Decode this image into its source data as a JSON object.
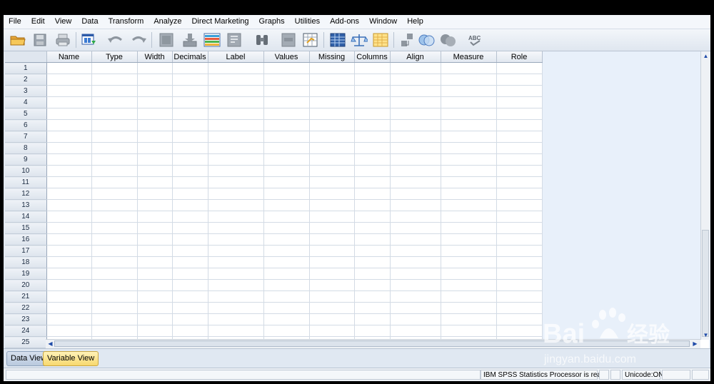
{
  "menu": [
    "File",
    "Edit",
    "View",
    "Data",
    "Transform",
    "Analyze",
    "Direct Marketing",
    "Graphs",
    "Utilities",
    "Add-ons",
    "Window",
    "Help"
  ],
  "toolbar": [
    "open-folder-icon",
    "save-icon",
    "print-icon",
    "recall-dialog-icon",
    "undo-icon",
    "redo-icon",
    "goto-case-icon",
    "goto-variable-icon",
    "variables-icon",
    "run-descriptives-icon",
    "find-icon",
    "insert-cases-icon",
    "insert-variable-icon",
    "split-file-icon",
    "weight-cases-icon",
    "select-cases-icon",
    "value-labels-icon",
    "use-sets-icon",
    "show-all-variables-icon",
    "spell-check-icon"
  ],
  "grid": {
    "columns": [
      "Name",
      "Type",
      "Width",
      "Decimals",
      "Label",
      "Values",
      "Missing",
      "Columns",
      "Align",
      "Measure",
      "Role"
    ],
    "rows": [
      "1",
      "2",
      "3",
      "4",
      "5",
      "6",
      "7",
      "8",
      "9",
      "10",
      "11",
      "12",
      "13",
      "14",
      "15",
      "16",
      "17",
      "18",
      "19",
      "20",
      "21",
      "22",
      "23",
      "24",
      "25"
    ]
  },
  "tabs": {
    "data_view": "Data View",
    "variable_view": "Variable View"
  },
  "status": {
    "processor": "IBM SPSS Statistics Processor is ready",
    "unicode": "Unicode:ON"
  },
  "watermark": {
    "brand": "Bai",
    "brand_cn": "经验",
    "url": "jingyan.baidu.com"
  },
  "colors": {
    "accent": "#1e4aa8",
    "active_tab": "#f7d86e"
  }
}
